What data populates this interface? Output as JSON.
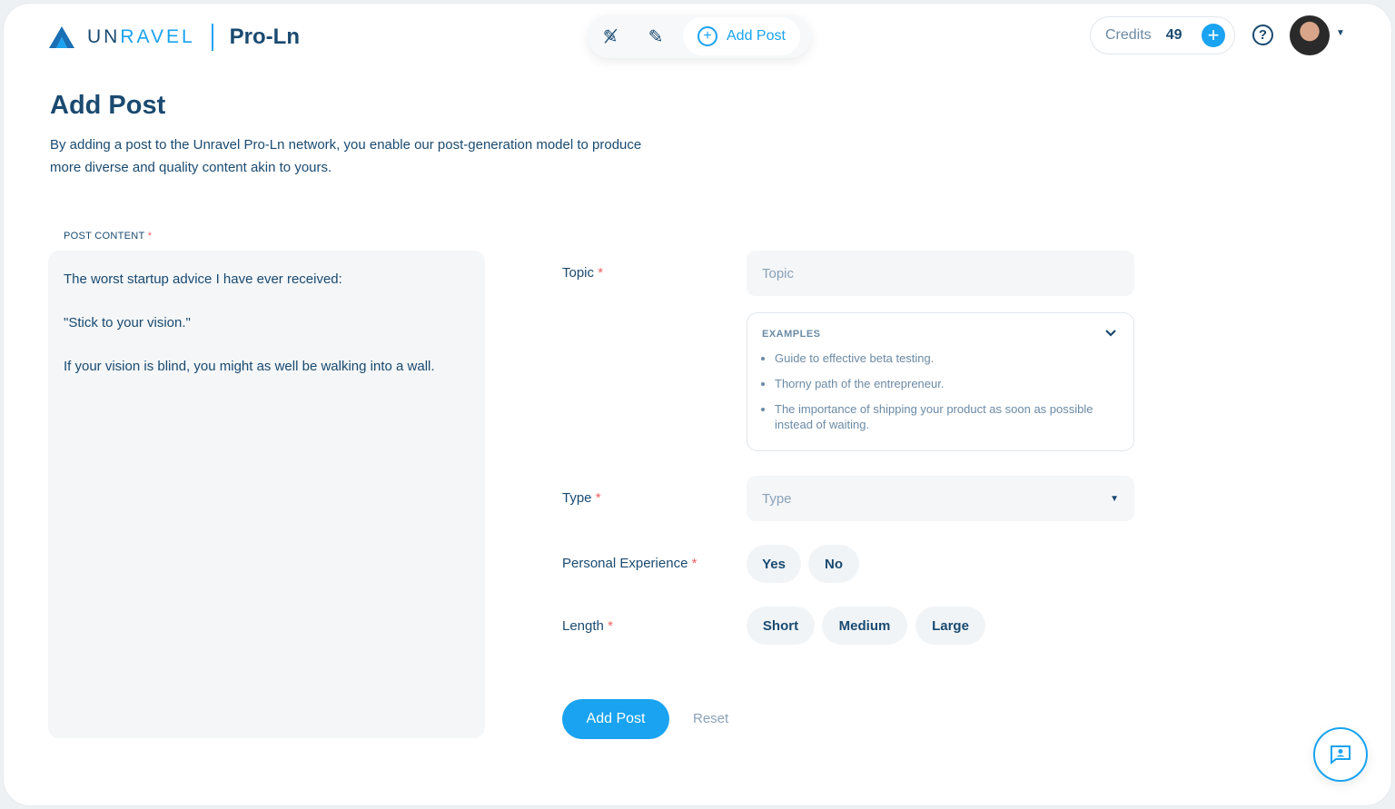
{
  "header": {
    "brand": "UNRAVEL",
    "brand_accent_split": 2,
    "product": "Pro-Ln",
    "toolbar": {
      "add_post": "Add Post"
    },
    "credits_label": "Credits",
    "credits_value": "49"
  },
  "page": {
    "title": "Add Post",
    "description": "By adding a post to the Unravel Pro-Ln network, you enable our post-generation model to produce more diverse and quality content akin to yours."
  },
  "form": {
    "post_content_label": "POST CONTENT",
    "post_content_value": "The worst startup advice I have ever received:\n\n\"Stick to your vision.\"\n\nIf your vision is blind, you might as well be walking into a wall.",
    "required_mark": "*",
    "topic_label": "Topic",
    "topic_placeholder": "Topic",
    "examples_title": "EXAMPLES",
    "examples": [
      "Guide to effective beta testing.",
      "Thorny path of the entrepreneur.",
      "The importance of shipping your product as soon as possible instead of waiting."
    ],
    "type_label": "Type",
    "type_placeholder": "Type",
    "personal_label": "Personal Experience",
    "personal_options": [
      "Yes",
      "No"
    ],
    "length_label": "Length",
    "length_options": [
      "Short",
      "Medium",
      "Large"
    ],
    "submit": "Add Post",
    "reset": "Reset"
  },
  "colors": {
    "accent": "#19a3f0",
    "primary_text": "#1a4a70"
  }
}
